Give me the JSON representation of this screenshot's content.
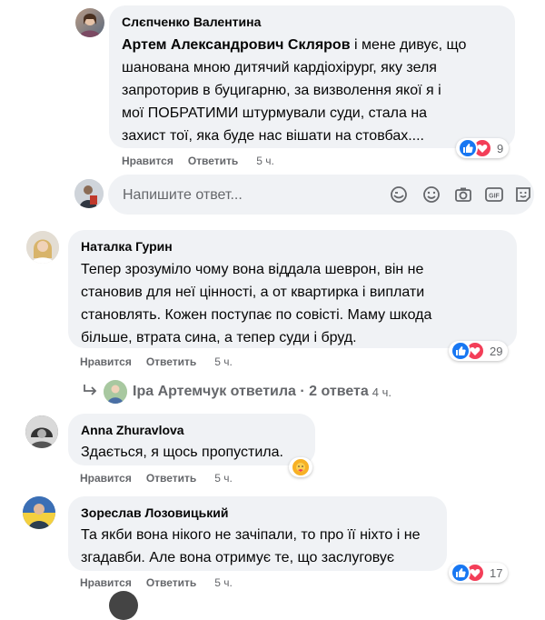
{
  "comments": [
    {
      "author": "Слєпченко Валентина",
      "mention": "Артем Александрович Скляров",
      "lines": [
        " і мене дивує, що",
        "шанована мною дитячий кардіохірург, яку зеля",
        "запроторив в буцигарню, за визволення якої я і",
        "мої ПОБРАТИМИ штурмували суди, стала на",
        "захист тої, яка буде нас вішати на стовбах...."
      ],
      "like_label": "Нравится",
      "reply_label": "Ответить",
      "time": "5 ч.",
      "reaction_count": "9"
    },
    {
      "author": "Наталка Гурин",
      "lines": [
        "Тепер зрозуміло чому вона віддала шеврон, він не",
        "становив для неї цінності, а от квартирка і виплати",
        "становлять. Кожен поступає по совісті. Маму шкода",
        "більше, втрата сина, а тепер суди і бруд."
      ],
      "like_label": "Нравится",
      "reply_label": "Ответить",
      "time": "5 ч.",
      "reaction_count": "29"
    },
    {
      "author": "Anna Zhuravlova",
      "lines": [
        "Здається, я щось пропустила."
      ],
      "like_label": "Нравится",
      "reply_label": "Ответить",
      "time": "5 ч."
    },
    {
      "author": "Зореслав Лозовицький",
      "lines": [
        "Та якби вона нікого не зачіпали, то про її ніхто і не",
        "згадавби. Але вона отримує те, що заслуговує"
      ],
      "like_label": "Нравится",
      "reply_label": "Ответить",
      "time": "5 ч.",
      "reaction_count": "17"
    }
  ],
  "reply_input": {
    "placeholder": "Напишите ответ..."
  },
  "thread": {
    "text": "Іра Артемчук ответила · 2 ответа",
    "time": "4 ч."
  },
  "colors": {
    "bubble": "#f0f2f5",
    "like": "#1877f2",
    "love": "#f33e58",
    "care": "#f7b125",
    "secondary_text": "#65676b"
  },
  "icons": [
    "like-reaction-icon",
    "love-reaction-icon",
    "care-reaction-icon",
    "sticker-icon",
    "emoji-icon",
    "camera-icon",
    "gif-icon",
    "avatar-sticker-icon",
    "reply-arrow-icon"
  ]
}
